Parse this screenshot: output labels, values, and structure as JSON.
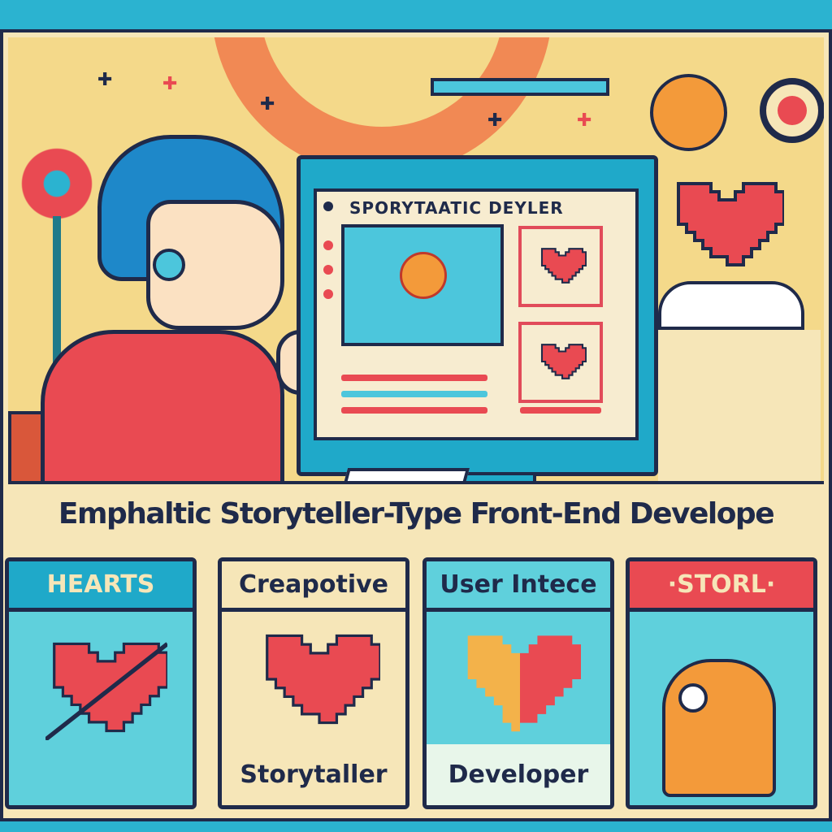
{
  "scene": {
    "screen_title": "SPORYTAATIC DEYLER"
  },
  "title": "Emphaltic Storyteller-Type Front-End Develope",
  "cards": [
    {
      "header": "HEARTS",
      "footer": "",
      "color": "#1fa9c9",
      "header_color": "#f6e6b8"
    },
    {
      "header": "Creapotive",
      "footer": "Storytaller",
      "color": "#f6e6b8",
      "header_color": "#1f2a4a"
    },
    {
      "header": "User Intece",
      "footer": "Developer",
      "color": "#5fd0dc",
      "header_color": "#1f2a4a"
    },
    {
      "header": "·STORL·",
      "footer": "",
      "color": "#e94a52",
      "header_color": "#f6e6b8"
    }
  ],
  "colors": {
    "accent": "#e94a52",
    "teal": "#1fa9c9",
    "ink": "#1f2a4a",
    "cream": "#f6e6b8"
  }
}
